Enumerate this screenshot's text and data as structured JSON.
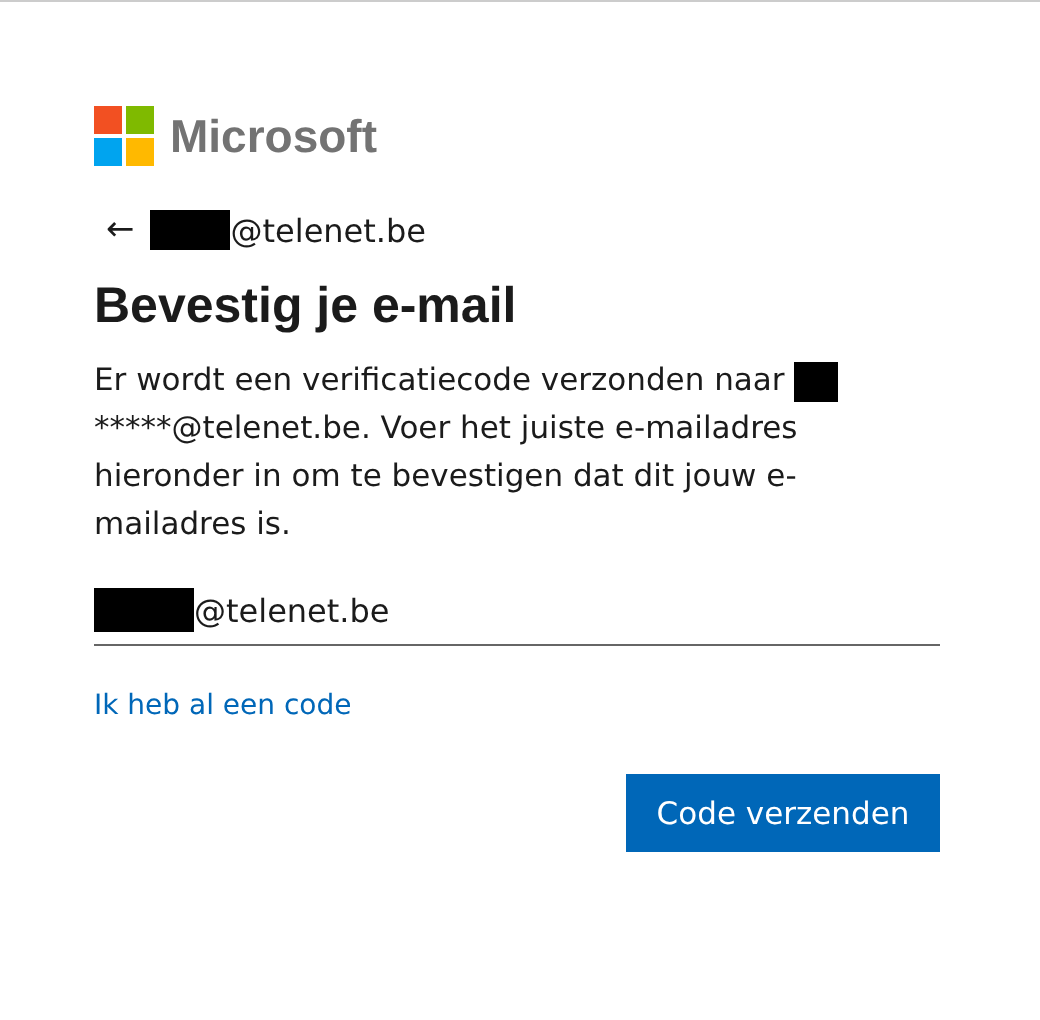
{
  "logo": {
    "text": "Microsoft"
  },
  "account": {
    "back_arrow": "←",
    "email": "@telenet.be"
  },
  "heading": "Bevestig je e-mail",
  "message": {
    "before": "Er wordt een verificatiecode verzonden naar",
    "after": "*****@telenet.be. Voer het juiste e-mailadres hieronder in om te bevestigen dat dit jouw e-mailadres is."
  },
  "email_field": {
    "value": "@telenet.be"
  },
  "link": "Ik heb al een code",
  "buttons": [
    {
      "label": "Code verzenden",
      "kind": "primary"
    }
  ]
}
